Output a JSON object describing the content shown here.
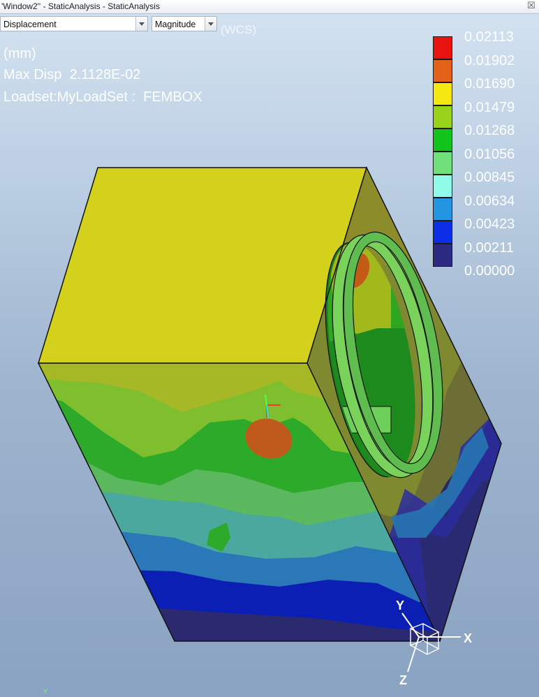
{
  "window": {
    "title": "'Window2'' - StaticAnalysis - StaticAnalysis",
    "close_glyph": "☒"
  },
  "toolbar": {
    "result_type": "Displacement",
    "component": "Magnitude",
    "coord_system": "(WCS)"
  },
  "info": {
    "units": "(mm)",
    "max_disp": "Max Disp  2.1128E-02",
    "loadset": "Loadset:MyLoadSet :  FEMBOX"
  },
  "legend": {
    "levels": [
      "0.02113",
      "0.01902",
      "0.01690",
      "0.01479",
      "0.01268",
      "0.01056",
      "0.00845",
      "0.00634",
      "0.00423",
      "0.00211",
      "0.00000"
    ],
    "colors": [
      "#e8130e",
      "#e2621a",
      "#f4e810",
      "#98d21a",
      "#12c31c",
      "#6fe07a",
      "#90fbe8",
      "#2495e0",
      "#0b2ee6",
      "#2d2a82"
    ]
  },
  "triad": {
    "x": "X",
    "y": "Y",
    "z": "Z"
  },
  "corner_y": "Y"
}
